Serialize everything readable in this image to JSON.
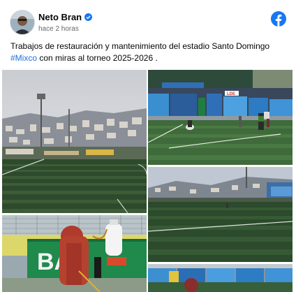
{
  "post": {
    "author": "Neto Bran",
    "timestamp": "hace 2 horas",
    "verified_icon": "verified-badge-icon",
    "brand_icon": "facebook-logo-icon",
    "brand_color": "#1877f2",
    "caption_line1": "Trabajos de restauración y mantenimiento del estadio Santo Domingo",
    "hashtag": "#Mixco",
    "caption_rest": " con miras al torneo 2025-2026 .",
    "hashtag_color": "#216fdb"
  },
  "photos": {
    "photo1_ad": "",
    "photo2_banner": "LDE",
    "photo5_sign": "BAN"
  }
}
